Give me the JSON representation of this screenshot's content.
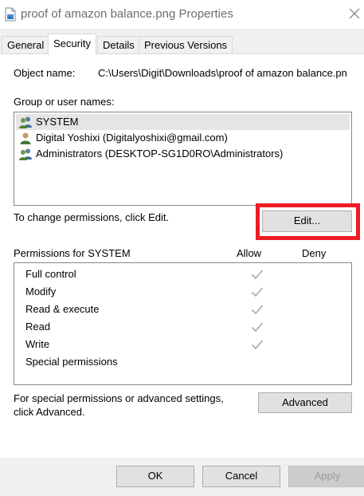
{
  "window": {
    "title": "proof of amazon balance.png Properties",
    "icon": "image-file-icon",
    "close_icon": "close-icon"
  },
  "tabs": [
    {
      "label": "General",
      "active": false
    },
    {
      "label": "Security",
      "active": true
    },
    {
      "label": "Details",
      "active": false
    },
    {
      "label": "Previous Versions",
      "active": false
    }
  ],
  "security": {
    "object_name_label": "Object name:",
    "object_name_value": "C:\\Users\\Digit\\Downloads\\proof of amazon balance.pn",
    "group_label": "Group or user names:",
    "groups": [
      {
        "name": "SYSTEM",
        "icon": "users-group-icon",
        "selected": true
      },
      {
        "name": "Digital Yoshixi (Digitalyoshixi@gmail.com)",
        "icon": "user-icon",
        "selected": false
      },
      {
        "name": "Administrators (DESKTOP-SG1D0RO\\Administrators)",
        "icon": "users-group-icon",
        "selected": false
      }
    ],
    "change_hint": "To change permissions, click Edit.",
    "edit_button": "Edit...",
    "permissions_header": "Permissions for SYSTEM",
    "allow_header": "Allow",
    "deny_header": "Deny",
    "permissions": [
      {
        "name": "Full control",
        "allow": true,
        "deny": false
      },
      {
        "name": "Modify",
        "allow": true,
        "deny": false
      },
      {
        "name": "Read & execute",
        "allow": true,
        "deny": false
      },
      {
        "name": "Read",
        "allow": true,
        "deny": false
      },
      {
        "name": "Write",
        "allow": true,
        "deny": false
      },
      {
        "name": "Special permissions",
        "allow": false,
        "deny": false
      }
    ],
    "advanced_hint_line1": "For special permissions or advanced settings,",
    "advanced_hint_line2": "click Advanced.",
    "advanced_button": "Advanced"
  },
  "footer": {
    "ok": "OK",
    "cancel": "Cancel",
    "apply": "Apply"
  },
  "colors": {
    "highlight_border": "#ee1c24",
    "selection": "#e5e5e5",
    "check_gray": "#a8a8a8"
  }
}
